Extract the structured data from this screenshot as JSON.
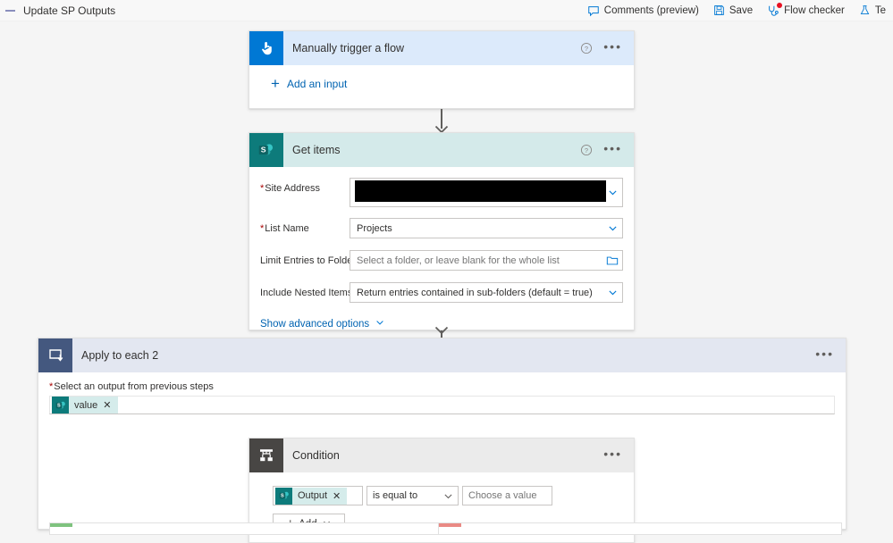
{
  "topbar": {
    "back_icon": "back-dash-icon",
    "title": "Update SP Outputs",
    "commands": [
      {
        "label": "Comments (preview)",
        "icon": "comment-icon",
        "badge": false
      },
      {
        "label": "Save",
        "icon": "save-icon",
        "badge": false
      },
      {
        "label": "Flow checker",
        "icon": "stethoscope-icon",
        "badge": true
      },
      {
        "label": "Te",
        "icon": "flask-icon",
        "badge": false
      }
    ]
  },
  "trigger_card": {
    "title": "Manually trigger a flow",
    "icon": "hand-tap-icon",
    "help_icon": "help-circle-icon",
    "menu_icon": "ellipsis-icon",
    "add_input_label": "Add an input",
    "add_input_icon": "plus-icon"
  },
  "getitems_card": {
    "title": "Get items",
    "icon": "sharepoint-icon",
    "help_icon": "help-circle-icon",
    "menu_icon": "ellipsis-icon",
    "fields": [
      {
        "label": "Site Address",
        "required": true,
        "value": "",
        "redacted": true,
        "control": "dropdown"
      },
      {
        "label": "List Name",
        "required": true,
        "value": "Projects",
        "control": "dropdown"
      },
      {
        "label": "Limit Entries to Folder",
        "required": false,
        "placeholder": "Select a folder, or leave blank for the whole list",
        "control": "folder-picker"
      },
      {
        "label": "Include Nested Items",
        "required": false,
        "value": "Return entries contained in sub-folders (default = true)",
        "control": "dropdown"
      }
    ],
    "advanced_link": "Show advanced options",
    "advanced_icon": "chevron-down-icon"
  },
  "apply_scope": {
    "title": "Apply to each 2",
    "icon": "loop-icon",
    "menu_icon": "ellipsis-icon",
    "output_label": "Select an output from previous steps",
    "output_required": true,
    "token": {
      "text": "value",
      "icon": "sharepoint-icon",
      "remove_icon": "close-icon"
    }
  },
  "condition_card": {
    "title": "Condition",
    "icon": "condition-branch-icon",
    "menu_icon": "ellipsis-icon",
    "left_token": {
      "text": "Output",
      "icon": "sharepoint-icon",
      "remove_icon": "close-icon"
    },
    "operator": "is equal to",
    "operator_icon": "chevron-down-icon",
    "right_placeholder": "Choose a value",
    "add_button": {
      "label": "Add",
      "plus_icon": "plus-icon",
      "chevron_icon": "chevron-down-icon"
    }
  },
  "branches": {
    "yes_color": "#7ec27e",
    "no_color": "#ea8a85"
  },
  "colors": {
    "accent": "#0078d4",
    "sharepoint_teal": "#0d7b7b",
    "loop_blue": "#44587f",
    "condition_gray": "#484644",
    "required_red": "#a80000",
    "badge_red": "#e81123"
  }
}
